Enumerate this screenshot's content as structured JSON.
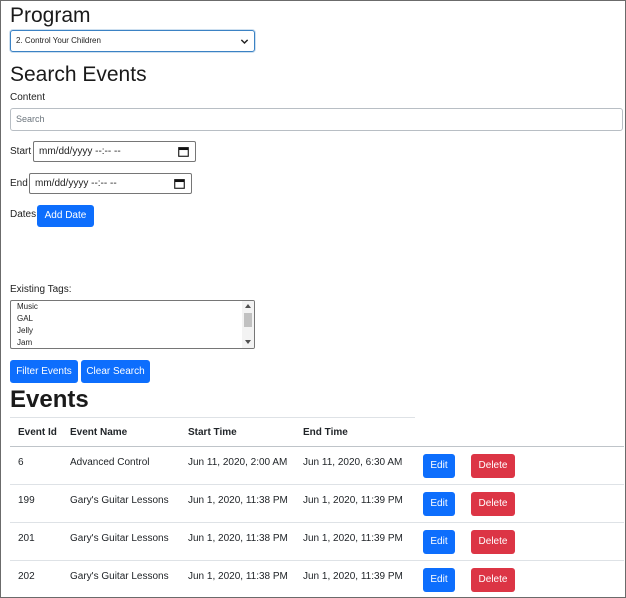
{
  "program": {
    "heading": "Program",
    "selected": "2. Control Your Children"
  },
  "search": {
    "heading": "Search Events",
    "content_label": "Content",
    "content_placeholder": "Search",
    "start_label": "Start",
    "start_value": "mm/dd/yyyy --:-- --",
    "end_label": "End",
    "end_value": "mm/dd/yyyy --:-- --",
    "dates_label": "Dates",
    "add_date_label": "Add Date",
    "tags_label": "Existing Tags:",
    "tags": [
      "Music",
      "GAL",
      "Jelly",
      "Jam"
    ],
    "filter_label": "Filter Events",
    "clear_label": "Clear Search"
  },
  "events": {
    "heading": "Events",
    "columns": [
      "Event Id",
      "Event Name",
      "Start Time",
      "End Time"
    ],
    "edit_label": "Edit",
    "delete_label": "Delete",
    "rows": [
      {
        "id": "6",
        "name": "Advanced Control",
        "start": "Jun 11, 2020, 2:00 AM",
        "end": "Jun 11, 2020, 6:30 AM"
      },
      {
        "id": "199",
        "name": "Gary's Guitar Lessons",
        "start": "Jun 1, 2020, 11:38 PM",
        "end": "Jun 1, 2020, 11:39 PM"
      },
      {
        "id": "201",
        "name": "Gary's Guitar Lessons",
        "start": "Jun 1, 2020, 11:38 PM",
        "end": "Jun 1, 2020, 11:39 PM"
      },
      {
        "id": "202",
        "name": "Gary's Guitar Lessons",
        "start": "Jun 1, 2020, 11:38 PM",
        "end": "Jun 1, 2020, 11:39 PM"
      }
    ]
  },
  "colors": {
    "primary": "#0d6efd",
    "danger": "#dc3545",
    "focus_border": "#3b82c4"
  },
  "icons": [
    "chevron-down-icon",
    "calendar-icon",
    "scroll-up-arrow-icon",
    "scroll-down-arrow-icon"
  ]
}
